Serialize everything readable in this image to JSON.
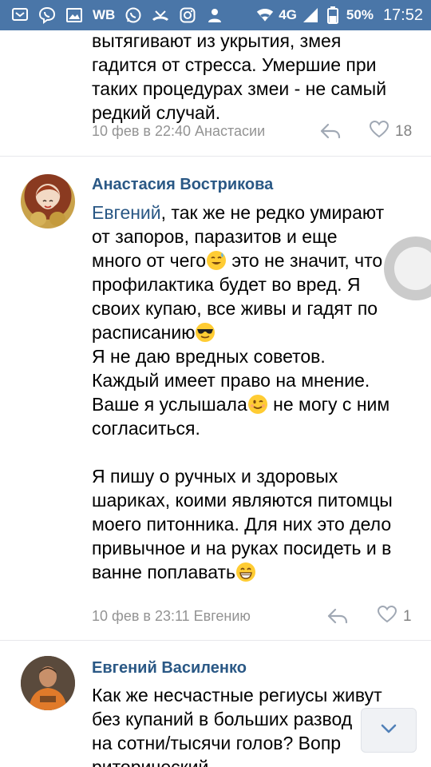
{
  "status_bar": {
    "carrier": "WB",
    "network": "4G",
    "battery": "50%",
    "time": "17:52",
    "icons": [
      "notification-icon",
      "viber-icon",
      "gallery-icon",
      "whatsapp-icon",
      "missed-call-icon",
      "instagram-icon",
      "person-icon",
      "wifi-icon",
      "signal-icon",
      "battery-icon"
    ]
  },
  "comments": [
    {
      "text_lines": [
        "вытягивают из укрытия, змея",
        "гадится от стресса. Умершие при",
        "таких процедурах змеи - не самый",
        "редкий случай."
      ],
      "meta": "10 фев в 22:40 Анастасии",
      "likes": "18"
    },
    {
      "author": "Анастасия Вострикова",
      "mention": "Евгений",
      "text_parts": {
        "p1a": ", так же не редко умирают",
        "p1b": "от запоров, паразитов и еще",
        "p1c": "много от чего",
        "p1d": " это не значит, что",
        "p1e": "профилактика будет во вред. Я",
        "p1f": "своих купаю, все живы и гадят по",
        "p1g": "расписанию",
        "p1h": "Я не даю вредных советов.",
        "p1i": "Каждый имеет право на мнение.",
        "p1j": "Ваше я услышала",
        "p1k": " не могу с ним",
        "p1l": "согласиться.",
        "p2a": "Я пишу о ручных и здоровых",
        "p2b": "шариках, коими являются питомцы",
        "p2c": "моего питонника. Для них это дело",
        "p2d": "привычное и на руках посидеть и в",
        "p2e": "ванне поплавать"
      },
      "meta": "10 фев в 23:11 Евгению",
      "likes": "1"
    },
    {
      "author": "Евгений Василенко",
      "text_lines": [
        "Как же несчастные региусы живут",
        "без купаний в больших развод",
        "на сотни/тысячи голов? Вопр",
        "риторический"
      ]
    }
  ],
  "colors": {
    "status_bar": "#4a76a8",
    "link": "#2a5885",
    "meta": "#939393",
    "divider": "#e7e8ec"
  }
}
